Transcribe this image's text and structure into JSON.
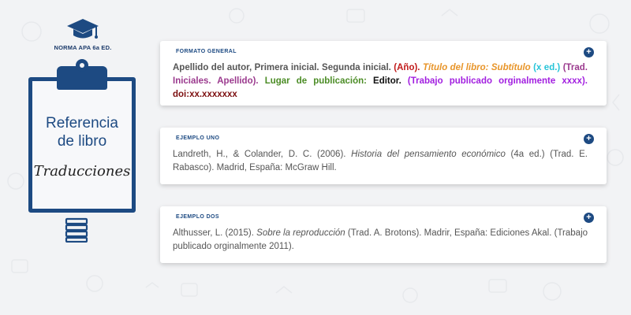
{
  "sidebar": {
    "norma_label": "NORMA APA 6a ED.",
    "board_title_line1": "Referencia",
    "board_title_line2": "de libro",
    "board_subtitle": "Traducciones",
    "icons": [
      "graduation-cap-icon",
      "books-icon"
    ],
    "brand_color": "#1d4a82"
  },
  "format_card": {
    "label": "FORMATO GENERAL",
    "parts": {
      "author": "Apellido del autor, Primera inicial. Segunda inicial.",
      "year": "(Año).",
      "title": "Título del libro: Subtítulo",
      "edition": "(x ed.)",
      "translator": "(Trad. Iniciales. Apellido).",
      "place": "Lugar de publicación:",
      "publisher": "Editor.",
      "original": "(Trabajo publicado orginalmente xxxx).",
      "doi": "doi:xx.xxxxxxx"
    }
  },
  "example_one": {
    "label": "EJEMPLO UNO",
    "before": "Landreth, H., & Colander, D. C. (2006).",
    "title": "Historia del pensamiento económico",
    "after": "(4a ed.) (Trad. E. Rabasco). Madrid, España: McGraw Hill."
  },
  "example_two": {
    "label": "EJEMPLO DOS",
    "before": "Althusser, L. (2015).",
    "title": "Sobre la reproducción",
    "after": "(Trad. A. Brotons). Madrir, España: Ediciones Akal. (Trabajo publicado orginalmente 2011)."
  },
  "colors": {
    "year": "#c11a1a",
    "title": "#e8952a",
    "edition": "#27c4d8",
    "translator": "#9b3a8e",
    "place": "#4b8c25",
    "publisher": "#111111",
    "original": "#a21fe0",
    "doi": "#7d0f10"
  }
}
